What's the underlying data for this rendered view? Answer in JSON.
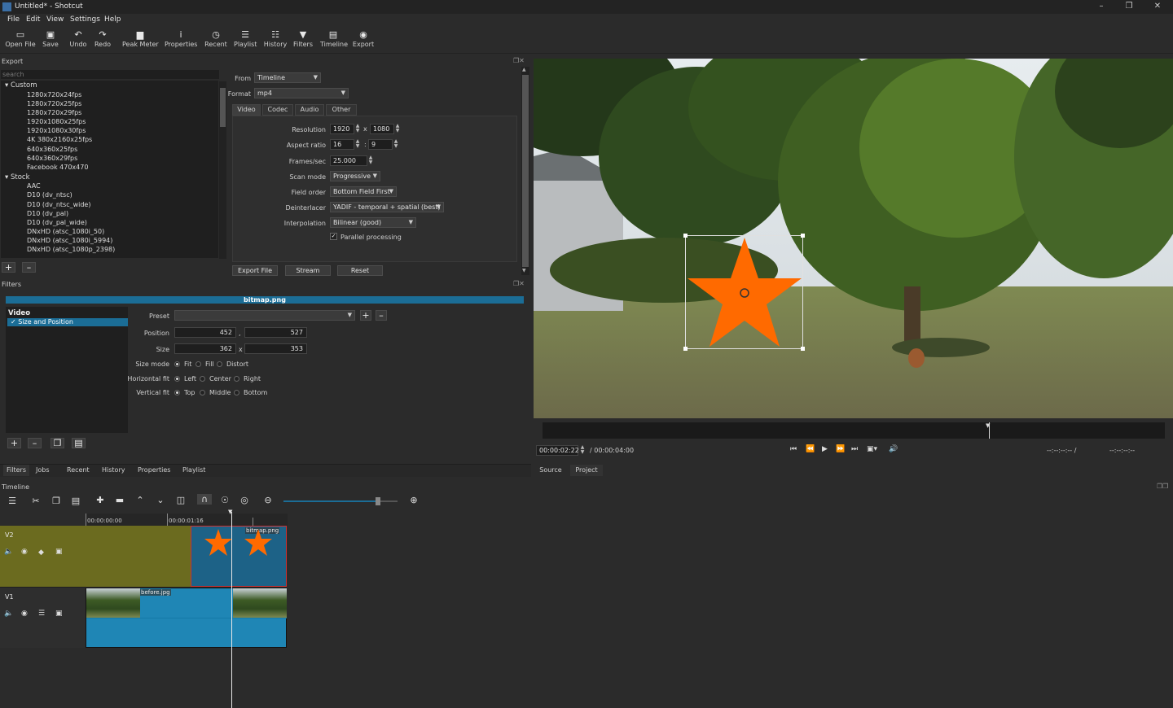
{
  "window": {
    "title": "Untitled* - Shotcut"
  },
  "menu": [
    "File",
    "Edit",
    "View",
    "Settings",
    "Help"
  ],
  "toolbar": [
    {
      "icon": "open-icon",
      "label": "Open File"
    },
    {
      "icon": "save-icon",
      "label": "Save"
    },
    {
      "icon": "undo-icon",
      "label": "Undo"
    },
    {
      "icon": "redo-icon",
      "label": "Redo"
    },
    {
      "icon": "peak-meter-icon",
      "label": "Peak Meter"
    },
    {
      "icon": "properties-icon",
      "label": "Properties"
    },
    {
      "icon": "recent-icon",
      "label": "Recent"
    },
    {
      "icon": "playlist-icon",
      "label": "Playlist"
    },
    {
      "icon": "history-icon",
      "label": "History"
    },
    {
      "icon": "filters-icon",
      "label": "Filters"
    },
    {
      "icon": "timeline-icon",
      "label": "Timeline"
    },
    {
      "icon": "export-icon",
      "label": "Export"
    }
  ],
  "export": {
    "header": "Export",
    "search_placeholder": "search",
    "groups": [
      {
        "name": "Custom",
        "items": [
          "1280x720x24fps",
          "1280x720x25fps",
          "1280x720x29fps",
          "1920x1080x25fps",
          "1920x1080x30fps",
          "4K 380x2160x25fps",
          "640x360x25fps",
          "640x360x29fps",
          "Facebook 470x470"
        ]
      },
      {
        "name": "Stock",
        "items": [
          "AAC",
          "D10 (dv_ntsc)",
          "D10 (dv_ntsc_wide)",
          "D10 (dv_pal)",
          "D10 (dv_pal_wide)",
          "DNxHD (atsc_1080i_50)",
          "DNxHD (atsc_1080i_5994)",
          "DNxHD (atsc_1080p_2398)"
        ]
      }
    ],
    "from_label": "From",
    "from_value": "Timeline",
    "format_label": "Format",
    "format_value": "mp4",
    "tabs": [
      "Video",
      "Codec",
      "Audio",
      "Other"
    ],
    "resolution_label": "Resolution",
    "res_w": "1920",
    "res_h": "1080",
    "aspect_label": "Aspect ratio",
    "aspect_w": "16",
    "aspect_h": "9",
    "fps_label": "Frames/sec",
    "fps": "25.000",
    "scan_label": "Scan mode",
    "scan": "Progressive",
    "field_label": "Field order",
    "field": "Bottom Field First",
    "deint_label": "Deinterlacer",
    "deint": "YADIF - temporal + spatial (best)",
    "interp_label": "Interpolation",
    "interp": "Bilinear (good)",
    "parallel_label": "Parallel processing",
    "x_sep": "x",
    "colon_sep": ":",
    "buttons": [
      "Export File",
      "Stream",
      "Reset"
    ]
  },
  "filters": {
    "header": "Filters",
    "clip_name": "bitmap.png",
    "category": "Video",
    "filter_item": "Size and Position",
    "preset_label": "Preset",
    "position_label": "Position",
    "pos_x": "452",
    "pos_y": "527",
    "comma": ",",
    "size_label": "Size",
    "size_w": "362",
    "size_h": "353",
    "x_sep": "x",
    "size_mode_label": "Size mode",
    "size_modes": [
      "Fit",
      "Fill",
      "Distort"
    ],
    "hfit_label": "Horizontal fit",
    "hfits": [
      "Left",
      "Center",
      "Right"
    ],
    "vfit_label": "Vertical fit",
    "vfits": [
      "Top",
      "Middle",
      "Bottom"
    ]
  },
  "bottom_tabs": [
    "Filters",
    "Jobs",
    "Recent",
    "History",
    "Properties",
    "Playlist"
  ],
  "player": {
    "timecode": "00:00:02:22",
    "duration": "/ 00:00:04:00",
    "in_point": "--:--:--:-- /",
    "out_point": "--:--:--:--",
    "tabs": [
      "Source",
      "Project"
    ]
  },
  "timeline": {
    "header": "Timeline",
    "ruler": [
      "00:00:00:00",
      "00:00:01:16"
    ],
    "tracks": [
      {
        "name": "V2",
        "clip_label": "bitmap.png"
      },
      {
        "name": "V1",
        "clip_label": "before.jpg"
      }
    ]
  },
  "colors": {
    "accent": "#1b6d96",
    "star": "#ff6a00",
    "v2_clip": "#6b6b1f"
  }
}
